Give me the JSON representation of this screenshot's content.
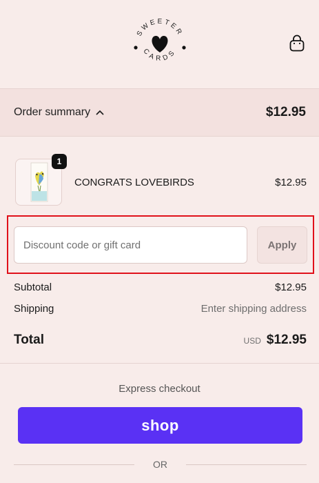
{
  "brand": {
    "logo_text_top": "SWEETER",
    "logo_text_bottom": "CARDS",
    "logo_icon": "heart-icon"
  },
  "header": {
    "cart_icon": "shopping-bag-icon"
  },
  "summary": {
    "toggle_label": "Order summary",
    "toggle_icon": "chevron-up-icon",
    "total": "$12.95"
  },
  "items": [
    {
      "name": "CONGRATS LOVEBIRDS",
      "price": "$12.95",
      "quantity": "1"
    }
  ],
  "discount": {
    "placeholder": "Discount code or gift card",
    "value": "",
    "apply_label": "Apply"
  },
  "totals": {
    "subtotal_label": "Subtotal",
    "subtotal_value": "$12.95",
    "shipping_label": "Shipping",
    "shipping_value": "Enter shipping address",
    "total_label": "Total",
    "currency": "USD",
    "total_value": "$12.95"
  },
  "express": {
    "label": "Express checkout",
    "shop_label": "shop",
    "or_label": "OR"
  },
  "colors": {
    "background": "#f8ecea",
    "summary_bar": "#f3e1df",
    "shop_purple": "#5a31f4",
    "highlight_red": "#e0101a"
  }
}
